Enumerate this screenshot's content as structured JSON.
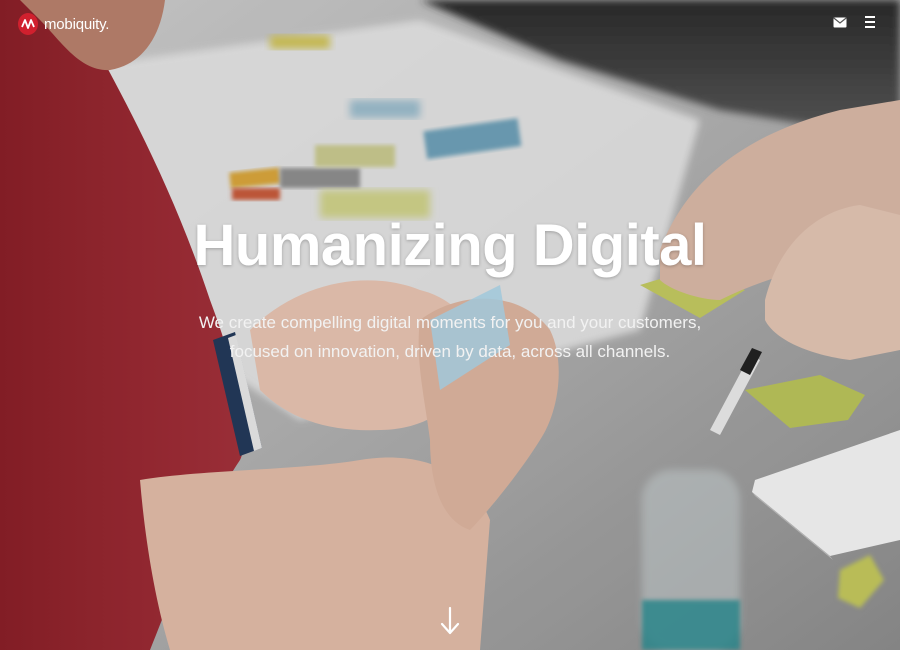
{
  "brand": {
    "name": "mobiquity.",
    "logo_color": "#d0202e"
  },
  "header": {
    "icons": [
      "mail-icon",
      "menu-icon"
    ]
  },
  "hero": {
    "title": "Humanizing Digital",
    "subtitle_line1": "We create compelling digital moments for you and your customers,",
    "subtitle_line2": "focused on innovation, driven by data, across all channels.",
    "scroll_icon": "arrow-down-icon"
  },
  "colors": {
    "text": "#ffffff",
    "shirt": "#9b2630",
    "table": "#d8d8d8"
  }
}
